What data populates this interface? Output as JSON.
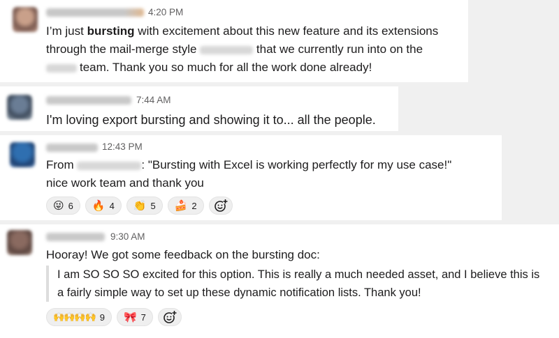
{
  "messages": [
    {
      "time": "4:20 PM",
      "lines": [
        [
          "I’m just ",
          "bursting",
          " with excitement about this new feature and its extensions"
        ],
        [
          "through the mail-merge style",
          "that we currently run into on the"
        ],
        [
          "team. Thank you so much for all the work done already!"
        ]
      ]
    },
    {
      "time": "7:44 AM",
      "line1": "I'm loving export bursting and showing it to... all the people."
    },
    {
      "time": "12:43 PM",
      "line1_prefix": "From",
      "line1_suffix": ": \"Bursting with Excel is working perfectly for my use case!\"",
      "line2": "nice work team and thank you",
      "reactions": [
        {
          "icon": "face-with-tongue-icon",
          "glyph": "😜",
          "count": "6"
        },
        {
          "icon": "fire-icon",
          "glyph": "🔥",
          "count": "4"
        },
        {
          "icon": "clapping-hands-icon",
          "glyph": "👏",
          "count": "5"
        },
        {
          "icon": "cake-icon",
          "glyph": "🍰",
          "count": "2"
        }
      ]
    },
    {
      "time": "9:30 AM",
      "line1": "Hooray! We got some feedback on the bursting doc:",
      "quote1": "I am SO SO SO excited for this option. This is really a much needed asset, and I believe this is",
      "quote2": "a fairly simple way to set up these dynamic notification lists. Thank you!",
      "reactions": [
        {
          "icon": "raised-hands-icon",
          "glyph": "🙌🙌🙌🙌",
          "count": "9"
        },
        {
          "icon": "ribbon-icon",
          "glyph": "🎀",
          "count": "7"
        }
      ]
    }
  ]
}
